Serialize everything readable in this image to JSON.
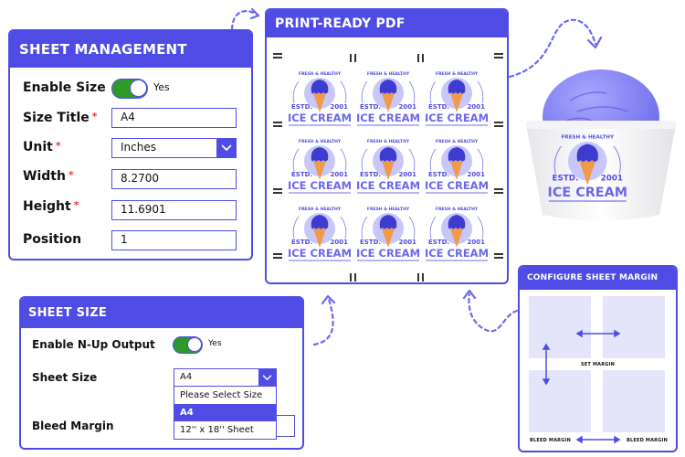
{
  "colors": {
    "brand": "#4f4ce6",
    "toggle_on": "#2d9a28",
    "required": "#e53935",
    "margin_box": "#e4e4fb"
  },
  "sheet_management": {
    "title": "SHEET MANAGEMENT",
    "enable_size": {
      "label": "Enable Size",
      "value": "Yes",
      "on": true
    },
    "size_title": {
      "label": "Size Title",
      "required": "*",
      "value": "A4"
    },
    "unit": {
      "label": "Unit",
      "required": "*",
      "value": "Inches",
      "icon": "chevron-down-icon"
    },
    "width": {
      "label": "Width",
      "required": "*",
      "value": "8.2700"
    },
    "height": {
      "label": "Height",
      "required": "*",
      "value": "11.6901"
    },
    "position": {
      "label": "Position",
      "value": "1"
    }
  },
  "sheet_size": {
    "title": "SHEET SIZE",
    "enable_nup": {
      "label": "Enable N-Up Output",
      "value": "Yes",
      "on": true
    },
    "sheet_size": {
      "label": "Sheet Size",
      "value": "A4",
      "icon": "chevron-down-icon",
      "options": [
        "Please Select Size",
        "A4",
        "12'' x 18'' Sheet"
      ],
      "active_option": "A4"
    },
    "bleed_margin": {
      "label": "Bleed Margin",
      "value": ""
    }
  },
  "print_ready_pdf": {
    "title": "PRINT-READY PDF",
    "label": {
      "arc_text": "FRESH & HEALTHY",
      "left": "ESTD.",
      "right": "2001",
      "name": "ICE CREAM"
    },
    "grid": {
      "rows": 3,
      "cols": 3
    }
  },
  "product": {
    "arc_text": "FRESH & HEALTHY",
    "left": "ESTD.",
    "right": "2001",
    "name": "ICE CREAM"
  },
  "configure_sheet_margin": {
    "title": "CONFIGURE SHEET MARGIN",
    "set_margin": "SET MARGIN",
    "bleed_margin_left": "BLEED MARGIN",
    "bleed_margin_right": "BLEED MARGIN"
  }
}
